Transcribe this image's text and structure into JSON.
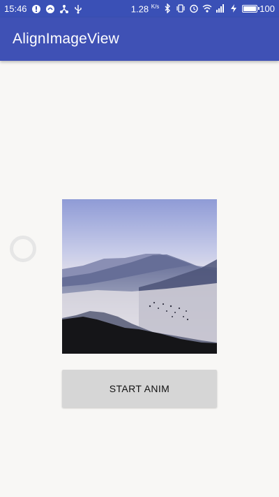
{
  "status_bar": {
    "time": "15:46",
    "net_speed": "1.28",
    "net_speed_unit": "K/s",
    "battery": "100",
    "icons_left": [
      "notification-icon",
      "chat-icon",
      "share-icon",
      "usb-icon"
    ],
    "icons_right": [
      "bluetooth-icon",
      "vibrate-icon",
      "alarm-icon",
      "wifi-icon",
      "signal-icon",
      "charging-icon",
      "battery-icon"
    ]
  },
  "app_bar": {
    "title": "AlignImageView",
    "color": "#3f51b5"
  },
  "content": {
    "image_icon": "mountain-landscape-image",
    "loading_indicator": "progress-spinner-icon",
    "start_button_label": "START ANIM"
  }
}
